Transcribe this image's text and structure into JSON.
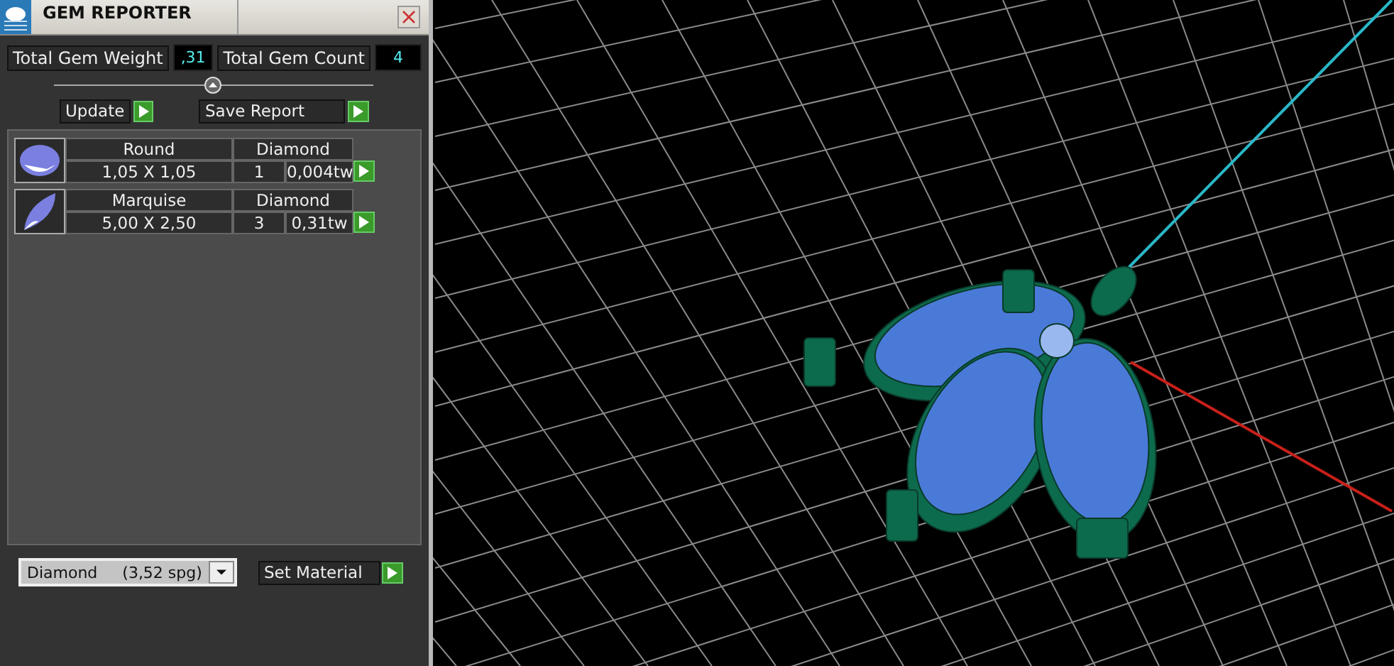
{
  "window": {
    "title": "GEM REPORTER"
  },
  "totals": [
    {
      "label": "Total Gem Weight",
      "value": ",31"
    },
    {
      "label": "Total Gem Count",
      "value": "4"
    }
  ],
  "actions": [
    "Update",
    "Save Report"
  ],
  "gems": [
    {
      "shape": "Round",
      "material": "Diamond",
      "size": "1,05 X 1,05",
      "count": "1",
      "weight": "0,004tw",
      "kind": "round"
    },
    {
      "shape": "Marquise",
      "material": "Diamond",
      "size": "5,00 X 2,50",
      "count": "3",
      "weight": "0,31tw",
      "kind": "marquise"
    }
  ],
  "material_select": {
    "value": "Diamond     (3,52 spg)"
  },
  "set_material": "Set Material"
}
